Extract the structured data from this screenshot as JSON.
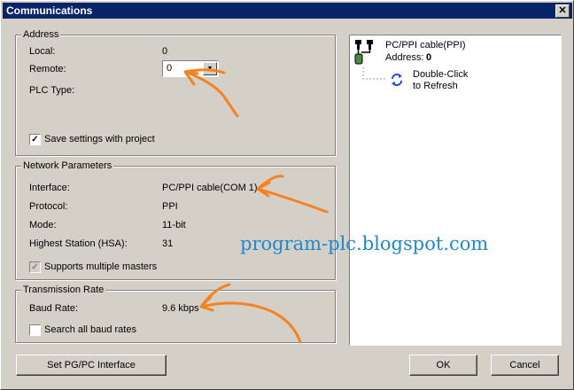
{
  "window": {
    "title": "Communications",
    "close_glyph": "✕"
  },
  "address": {
    "group_label": "Address",
    "local_label": "Local:",
    "local_value": "0",
    "remote_label": "Remote:",
    "remote_value": "0",
    "plc_type_label": "PLC Type:",
    "save_settings_label": "Save settings with project",
    "save_settings_checked": true
  },
  "network": {
    "group_label": "Network Parameters",
    "interface_label": "Interface:",
    "interface_value": "PC/PPI cable(COM 1)",
    "protocol_label": "Protocol:",
    "protocol_value": "PPI",
    "mode_label": "Mode:",
    "mode_value": "11-bit",
    "hsa_label": "Highest Station (HSA):",
    "hsa_value": "31",
    "multi_masters_label": "Supports multiple masters",
    "multi_masters_checked": true
  },
  "transmission": {
    "group_label": "Transmission Rate",
    "baud_label": "Baud Rate:",
    "baud_value": "9.6 kbps",
    "search_all_label": "Search all baud rates",
    "search_all_checked": false
  },
  "tree": {
    "cable_title": "PC/PPI cable(PPI)",
    "cable_address_label": "Address:",
    "cable_address_value": "0",
    "refresh_line1": "Double-Click",
    "refresh_line2": "to Refresh"
  },
  "buttons": {
    "set_interface": "Set PG/PC Interface",
    "ok": "OK",
    "cancel": "Cancel"
  },
  "watermark": "program-plc.blogspot.com",
  "colors": {
    "title_bar": "#0a246a",
    "face": "#d4d0c8",
    "annotation": "#f58220",
    "watermark": "#1e88d0",
    "refresh_icon": "#1a4fd6"
  },
  "icons": [
    "close-icon",
    "dropdown-arrow-icon",
    "checkmark-icon",
    "cable-icon",
    "refresh-icon"
  ]
}
